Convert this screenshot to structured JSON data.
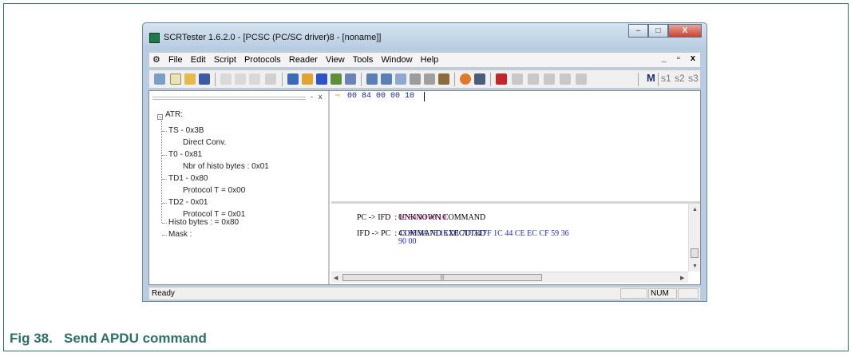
{
  "window": {
    "title": "SCRTester 1.6.2.0 - [PCSC (PC/SC driver)8 - [noname]]",
    "caption_buttons": [
      "–",
      "□",
      "X"
    ]
  },
  "menu": {
    "items": [
      "File",
      "Edit",
      "Script",
      "Protocols",
      "Reader",
      "View",
      "Tools",
      "Window",
      "Help"
    ],
    "mdi_controls": [
      "_",
      "▫",
      "x"
    ]
  },
  "toolbar": {
    "m_label": "M",
    "s_labels": [
      "s1",
      "s2",
      "s3"
    ]
  },
  "tree": {
    "controls": [
      "-",
      "x"
    ],
    "expander": "-",
    "items": [
      "ATR:",
      "TS  - 0x3B",
      "Direct Conv.",
      "T0  - 0x81",
      "Nbr of histo bytes : 0x01",
      "TD1 - 0x80",
      "Protocol T = 0x00",
      "TD2 - 0x01",
      "Protocol T = 0x01",
      "Histo bytes : = 0x80",
      "Mask :"
    ]
  },
  "command": {
    "text": "00 84 00 00 10"
  },
  "log": {
    "line1_prefix": "PC -> IFD  :",
    "line1_msg": "UNKNOWN COMMAND",
    "line2": "00 84 00 00 10",
    "line3_prefix": "IFD -> PC  :",
    "line3_msg": "COMMAND EXECUTED",
    "line4": "43 95 9A 75 16 D1 7D 74 7F 1C 44 CE EC CF 59 36",
    "line5": "90 00"
  },
  "status": {
    "ready": "Ready",
    "num": "NUM"
  },
  "caption": "Fig 38.   Send APDU command",
  "colors": {
    "caption": "#2e7068",
    "frame": "#2f6e65",
    "log_command": "#8a1c6d",
    "log_response": "#1f2bb3"
  }
}
